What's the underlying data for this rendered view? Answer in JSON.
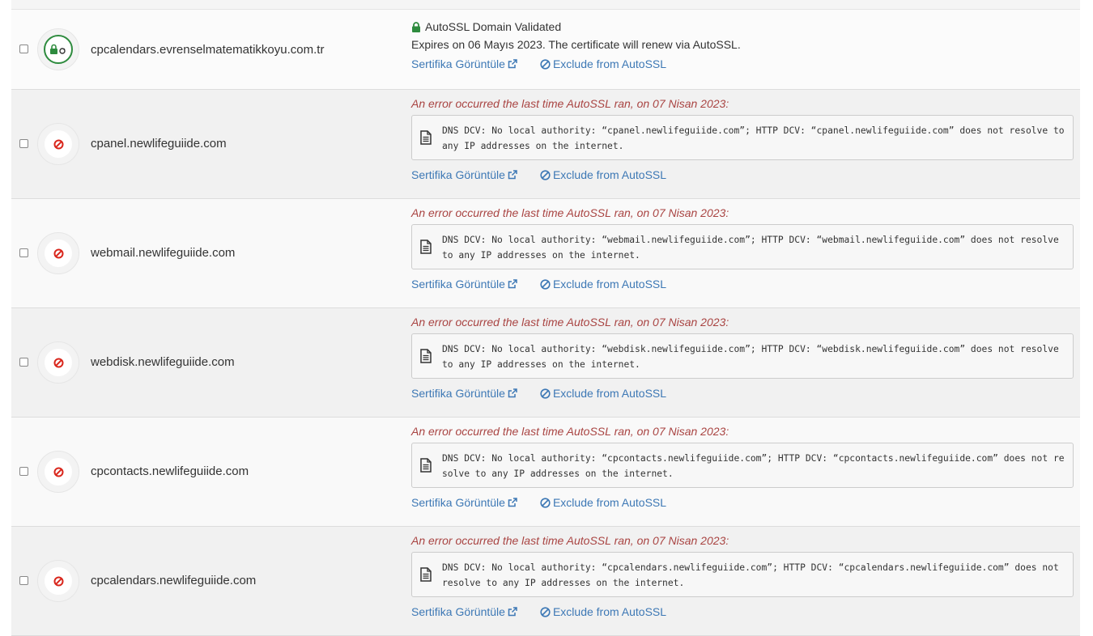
{
  "rows": [
    {
      "domain": "cpcalendars.evrenselmatematikkoyu.com.tr",
      "status": "ok",
      "ok_title": "AutoSSL Domain Validated",
      "expires": "Expires on 06 Mayıs 2023. The certificate will renew via AutoSSL.",
      "view_label": "Sertifika Görüntüle",
      "exclude_label": "Exclude from AutoSSL"
    },
    {
      "domain": "cpanel.newlifeguiide.com",
      "status": "error",
      "error_title": "An error occurred the last time AutoSSL ran, on 07 Nisan 2023:",
      "error_message": "DNS DCV: No local authority: “cpanel.newlifeguiide.com”; HTTP DCV: “cpanel.newlifeguiide.com” does not resolve to any IP addresses on the internet.",
      "view_label": "Sertifika Görüntüle",
      "exclude_label": "Exclude from AutoSSL"
    },
    {
      "domain": "webmail.newlifeguiide.com",
      "status": "error",
      "error_title": "An error occurred the last time AutoSSL ran, on 07 Nisan 2023:",
      "error_message": "DNS DCV: No local authority: “webmail.newlifeguiide.com”; HTTP DCV: “webmail.newlifeguiide.com” does not resolve to any IP addresses on the internet.",
      "view_label": "Sertifika Görüntüle",
      "exclude_label": "Exclude from AutoSSL"
    },
    {
      "domain": "webdisk.newlifeguiide.com",
      "status": "error",
      "error_title": "An error occurred the last time AutoSSL ran, on 07 Nisan 2023:",
      "error_message": "DNS DCV: No local authority: “webdisk.newlifeguiide.com”; HTTP DCV: “webdisk.newlifeguiide.com” does not resolve to any IP addresses on the internet.",
      "view_label": "Sertifika Görüntüle",
      "exclude_label": "Exclude from AutoSSL"
    },
    {
      "domain": "cpcontacts.newlifeguiide.com",
      "status": "error",
      "error_title": "An error occurred the last time AutoSSL ran, on 07 Nisan 2023:",
      "error_message": "DNS DCV: No local authority: “cpcontacts.newlifeguiide.com”; HTTP DCV: “cpcontacts.newlifeguiide.com” does not resolve to any IP addresses on the internet.",
      "view_label": "Sertifika Görüntüle",
      "exclude_label": "Exclude from AutoSSL"
    },
    {
      "domain": "cpcalendars.newlifeguiide.com",
      "status": "error",
      "error_title": "An error occurred the last time AutoSSL ran, on 07 Nisan 2023:",
      "error_message": "DNS DCV: No local authority: “cpcalendars.newlifeguiide.com”; HTTP DCV: “cpcalendars.newlifeguiide.com” does not resolve to any IP addresses on the internet.",
      "view_label": "Sertifika Görüntüle",
      "exclude_label": "Exclude from AutoSSL"
    }
  ],
  "icons": {
    "ok_status": "lock-sync-icon",
    "error_status": "prohibited-icon",
    "validated": "lock-icon",
    "error_detail": "document-icon",
    "view_link": "external-link-icon",
    "exclude_link": "ban-icon"
  },
  "colors": {
    "link": "#3d78b5",
    "error_text": "#a94442",
    "ok_green": "#2e8b3e",
    "error_red": "#d9261c"
  }
}
